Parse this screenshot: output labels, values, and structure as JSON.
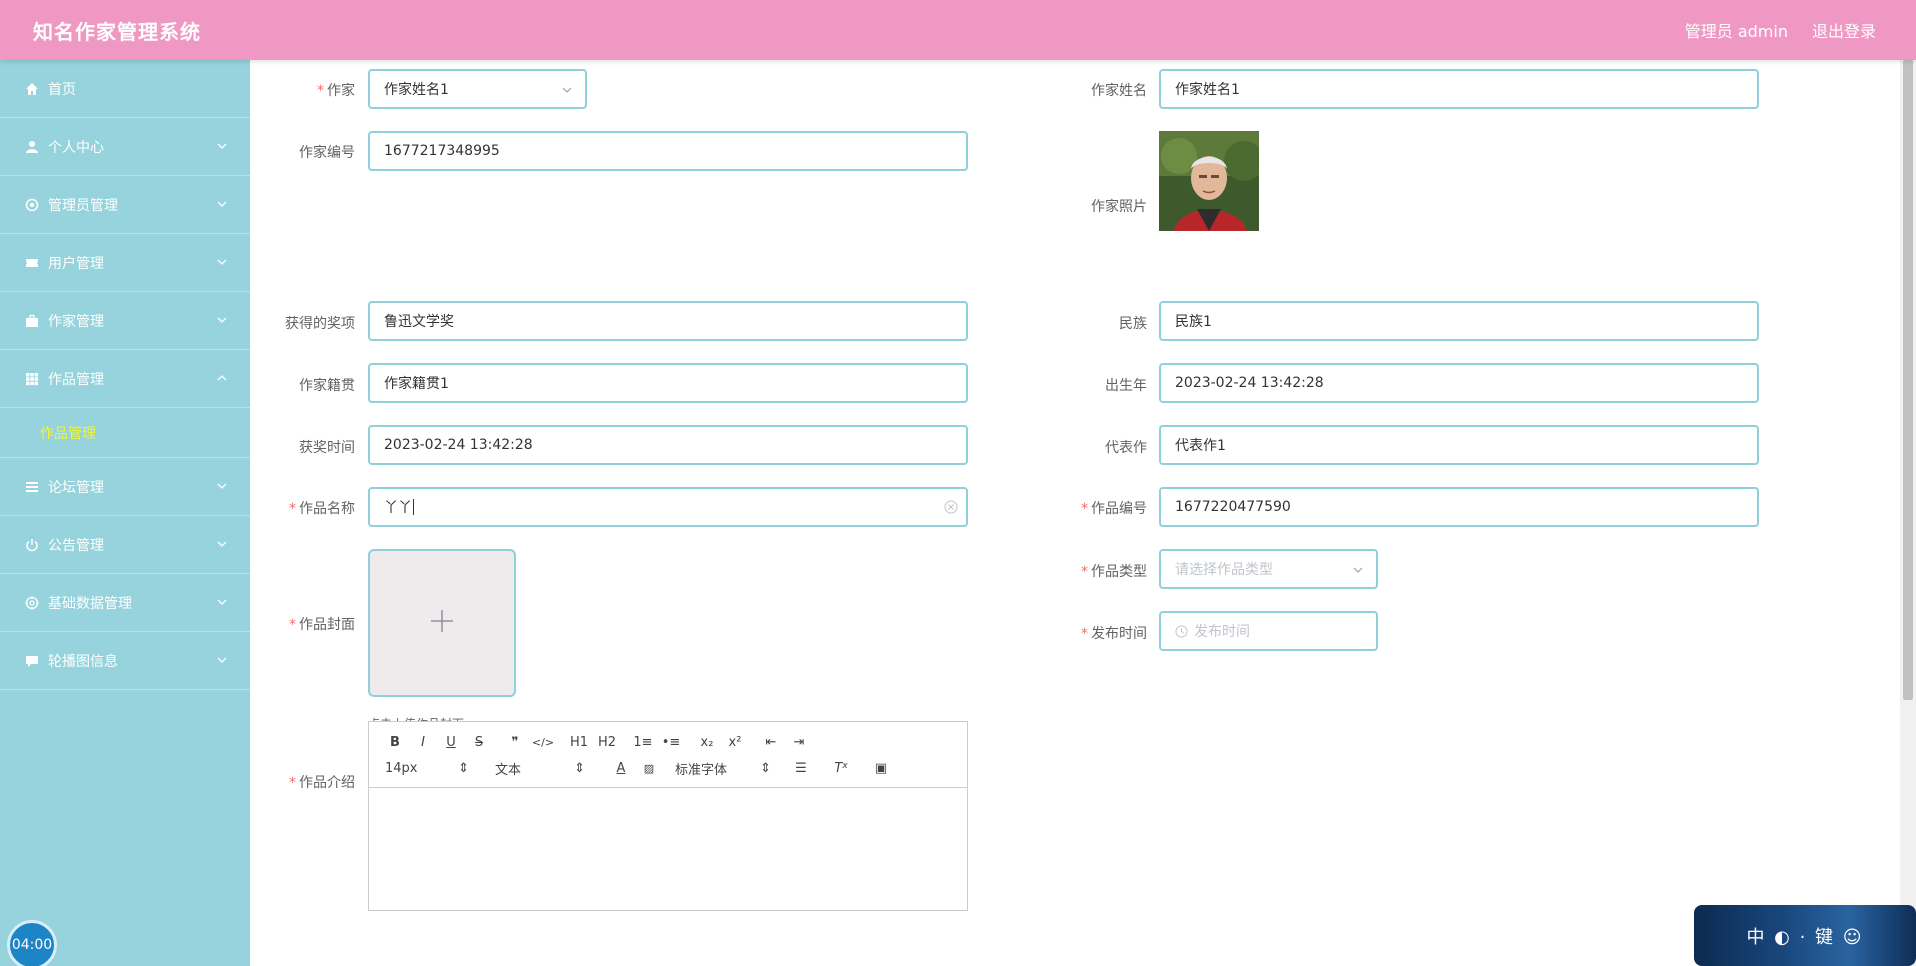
{
  "header": {
    "title": "知名作家管理系统",
    "user": "管理员 admin",
    "logout": "退出登录"
  },
  "sidebar": {
    "items": [
      {
        "label": "首页",
        "icon": "home-icon"
      },
      {
        "label": "个人中心",
        "icon": "user-icon"
      },
      {
        "label": "管理员管理",
        "icon": "settings-icon"
      },
      {
        "label": "用户管理",
        "icon": "ticket-icon"
      },
      {
        "label": "作家管理",
        "icon": "briefcase-icon"
      },
      {
        "label": "作品管理",
        "icon": "grid-icon"
      },
      {
        "label": "论坛管理",
        "icon": "list-icon"
      },
      {
        "label": "公告管理",
        "icon": "power-icon"
      },
      {
        "label": "基础数据管理",
        "icon": "target-icon"
      },
      {
        "label": "轮播图信息",
        "icon": "chat-icon"
      }
    ],
    "sub_item": "作品管理"
  },
  "form": {
    "writer": {
      "label": "作家",
      "value": "作家姓名1"
    },
    "writer_name": {
      "label": "作家姓名",
      "value": "作家姓名1"
    },
    "writer_no": {
      "label": "作家编号",
      "value": "1677217348995"
    },
    "writer_photo": {
      "label": "作家照片"
    },
    "award": {
      "label": "获得的奖项",
      "value": "鲁迅文学奖"
    },
    "ethnicity": {
      "label": "民族",
      "value": "民族1"
    },
    "native_place": {
      "label": "作家籍贯",
      "value": "作家籍贯1"
    },
    "birth_year": {
      "label": "出生年",
      "value": "2023-02-24 13:42:28"
    },
    "award_time": {
      "label": "获奖时间",
      "value": "2023-02-24 13:42:28"
    },
    "masterpiece": {
      "label": "代表作",
      "value": "代表作1"
    },
    "work_name": {
      "label": "作品名称",
      "value": "丫丫"
    },
    "work_no": {
      "label": "作品编号",
      "value": "1677220477590"
    },
    "work_cover": {
      "label": "作品封面",
      "hint": "点击上传作品封面"
    },
    "work_type": {
      "label": "作品类型",
      "placeholder": "请选择作品类型"
    },
    "publish_time": {
      "label": "发布时间",
      "placeholder": "发布时间"
    },
    "work_intro": {
      "label": "作品介绍"
    }
  },
  "editor": {
    "buttons_row1": [
      "B",
      "I",
      "U",
      "S",
      "❞",
      "</>",
      "H1",
      "H2",
      "1≡",
      "•≡",
      "x₂",
      "x²",
      "⇤",
      "⇥"
    ],
    "font_size": "14px",
    "header": "文本",
    "font_family": "标准字体"
  },
  "overlay": {
    "timer": "04:00",
    "banner_text": "中 ◐ · 键 ☺"
  }
}
